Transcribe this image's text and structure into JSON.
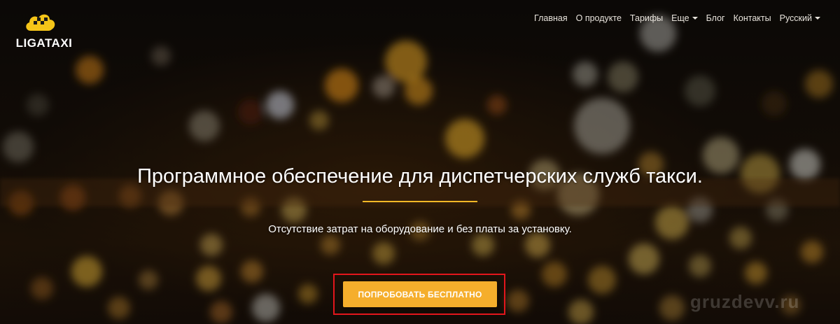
{
  "logo": {
    "text": "LIGATAXI"
  },
  "nav": {
    "items": [
      {
        "label": "Главная"
      },
      {
        "label": "О продукте"
      },
      {
        "label": "Тарифы"
      },
      {
        "label": "Еще"
      },
      {
        "label": "Блог"
      },
      {
        "label": "Контакты"
      },
      {
        "label": "Русский"
      }
    ]
  },
  "hero": {
    "headline": "Программное обеспечение для диспетчерских служб такси.",
    "subtitle": "Отсутствие затрат на оборудование и без платы за установку.",
    "cta_label": "ПОПРОБОВАТЬ БЕСПЛАТНО"
  },
  "watermark": "gruzdevv.ru",
  "colors": {
    "accent": "#f4b826",
    "button": "#f5ae2c",
    "highlight_frame": "#e3161c"
  }
}
